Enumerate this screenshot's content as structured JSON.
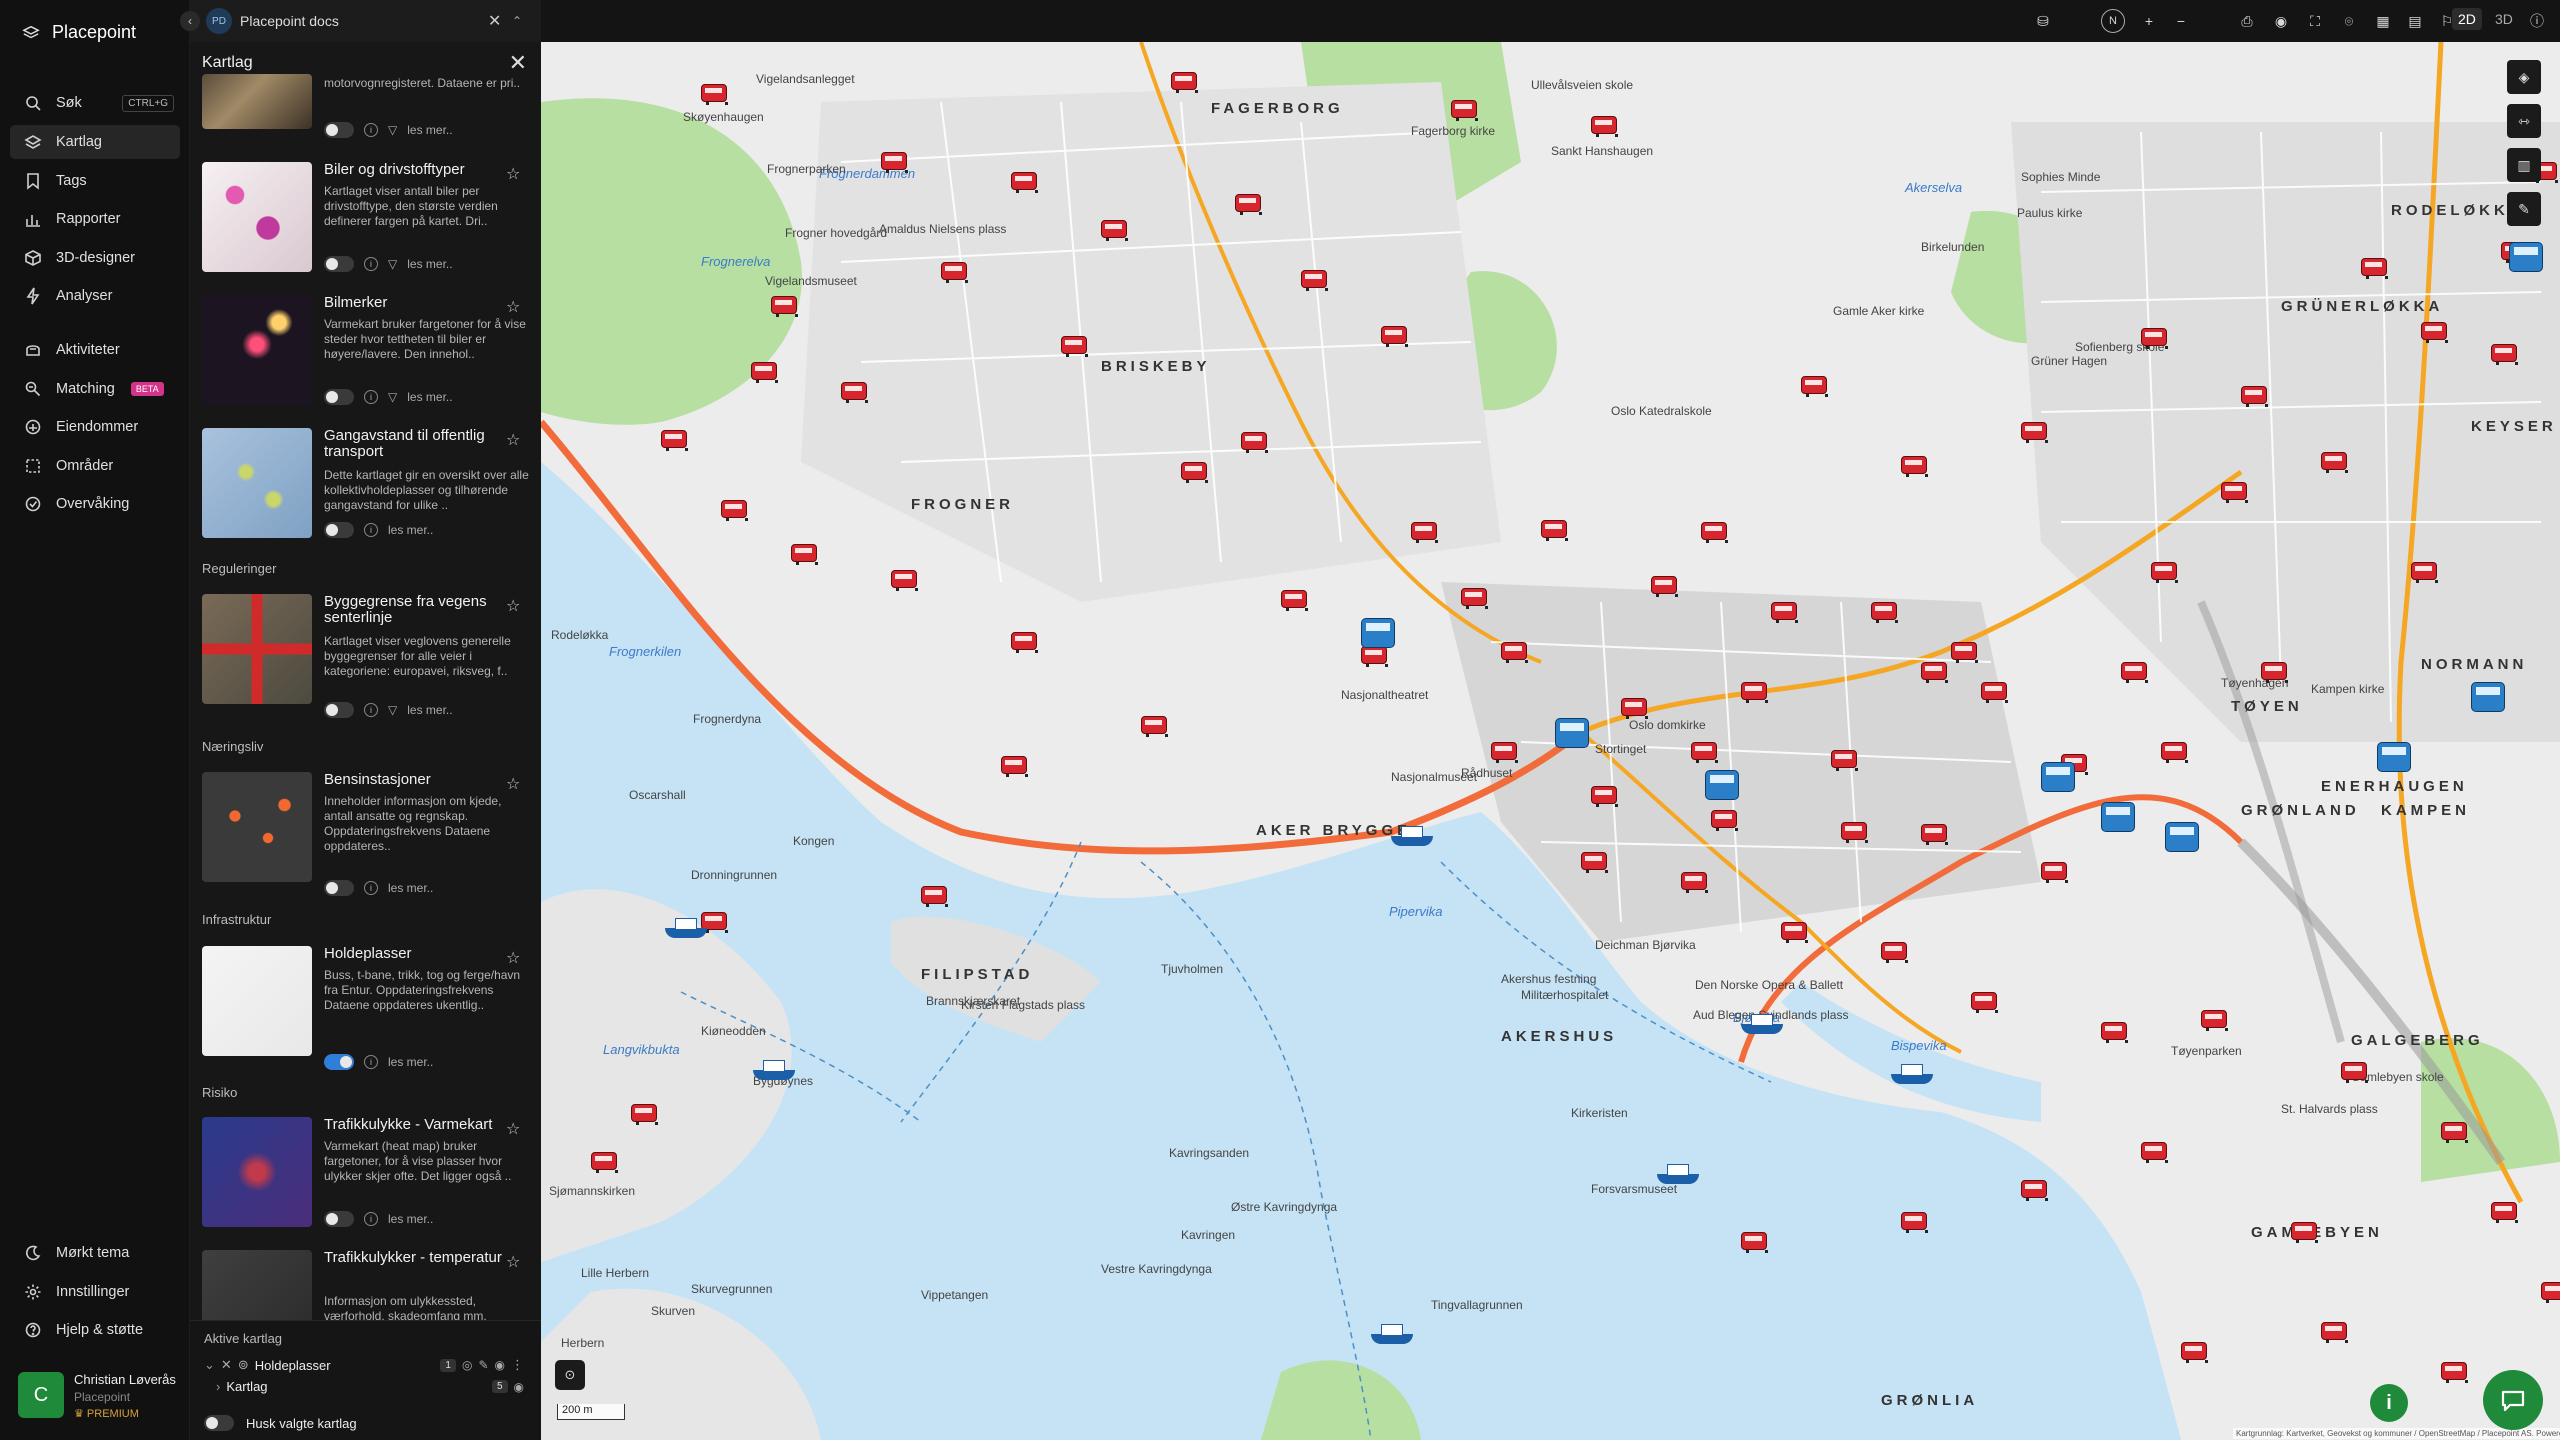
{
  "app": {
    "name": "Placepoint",
    "doc_badge": "PD",
    "doc_title": "Placepoint docs"
  },
  "nav": {
    "items": [
      {
        "label": "Søk",
        "icon": "search-icon",
        "shortcut": "CTRL+G"
      },
      {
        "label": "Kartlag",
        "icon": "layers-icon"
      },
      {
        "label": "Tags",
        "icon": "bookmark-icon"
      },
      {
        "label": "Rapporter",
        "icon": "chart-icon"
      },
      {
        "label": "3D-designer",
        "icon": "cube-icon"
      },
      {
        "label": "Analyser",
        "icon": "bolt-icon"
      },
      {
        "label": "Aktiviteter",
        "icon": "activity-icon"
      },
      {
        "label": "Matching",
        "icon": "matching-icon",
        "badge": "BETA"
      },
      {
        "label": "Eiendommer",
        "icon": "building-icon"
      },
      {
        "label": "Områder",
        "icon": "area-icon"
      },
      {
        "label": "Overvåking",
        "icon": "monitor-icon"
      }
    ],
    "bottom": [
      {
        "label": "Mørkt tema",
        "icon": "moon-icon"
      },
      {
        "label": "Innstillinger",
        "icon": "settings-icon"
      },
      {
        "label": "Hjelp & støtte",
        "icon": "help-icon"
      }
    ],
    "user": {
      "initial": "C",
      "name": "Christian Løverås",
      "org": "Placepoint",
      "tier": "PREMIUM"
    }
  },
  "panel": {
    "title": "Kartlag",
    "top_card": {
      "desc": "motorvognregisteret. Dataene er pri..",
      "more": "les mer.."
    },
    "sections": {
      "regulations": "Reguleringer",
      "business": "Næringsliv",
      "infrastructure": "Infrastruktur",
      "risk": "Risiko"
    },
    "cards": [
      {
        "title": "Biler og drivstofftyper",
        "desc": "Kartlaget viser antall biler per drivstofftype, den største verdien definerer fargen på kartet. Dri..",
        "more": "les mer.."
      },
      {
        "title": "Bilmerker",
        "desc": "Varmekart bruker fargetoner for å vise steder hvor tettheten til biler er høyere/lavere. Den innehol..",
        "more": "les mer.."
      },
      {
        "title": "Gangavstand til offentlig transport",
        "desc": "Dette kartlaget gir en oversikt over alle kollektivholdeplasser og tilhørende gangavstand for ulike ..",
        "more": "les mer.."
      },
      {
        "title": "Byggegrense fra vegens senterlinje",
        "desc": "Kartlaget viser veglovens generelle byggegrenser for alle veier i kategoriene: europavei, riksveg, f..",
        "more": "les mer.."
      },
      {
        "title": "Bensinstasjoner",
        "desc": "Inneholder informasjon om kjede, antall ansatte og regnskap. Oppdateringsfrekvens Dataene oppdateres..",
        "more": "les mer.."
      },
      {
        "title": "Holdeplasser",
        "desc": "Buss, t-bane, trikk, tog og ferge/havn fra Entur. Oppdateringsfrekvens Dataene oppdateres ukentlig..",
        "more": "les mer.."
      },
      {
        "title": "Trafikkulykke - Varmekart",
        "desc": "Varmekart (heat map) bruker fargetoner, for å vise plasser hvor ulykker skjer ofte. Det ligger også ..",
        "more": "les mer.."
      },
      {
        "title": "Trafikkulykker - temperatur",
        "desc": "Informasjon om ulykkessted, værforhold, skadeomfang mm.",
        "more": ""
      }
    ],
    "active": {
      "header": "Aktive kartlag",
      "layer1": "Holdeplasser",
      "layer1_count": "1",
      "layer2": "Kartlag",
      "layer2_count": "5",
      "remember": "Husk valgte kartlag"
    }
  },
  "topbar": {
    "mode_2d": "2D",
    "mode_3d": "3D",
    "north": "N"
  },
  "map": {
    "scale": "200 m",
    "attribution": "Kartgrunnlag: Kartverket, Geovekst og kommuner / OpenStreetMap / Placepoint AS. Powered by Esri",
    "districts": [
      "FAGERBORG",
      "RODELØKKA",
      "GRÜNERLØKKA",
      "BRISKEBY",
      "FROGNER",
      "KEYSER",
      "AKER BRYGGE",
      "FILIPSTAD",
      "AKERSHUS",
      "GRØNLAND",
      "ENERHAUGEN",
      "TØYEN",
      "NORMANN",
      "KAMPEN",
      "GALGEBERG",
      "GAMLEBYEN",
      "GRØNLIA"
    ],
    "water": [
      "Frognerelva",
      "Frognerdammen",
      "Akerselva",
      "Frognerkilen",
      "Pipervika",
      "Bjørvika",
      "Bispevika",
      "Langvikbukta"
    ],
    "places": [
      "Vigelandsanlegget",
      "Skøyenhaugen",
      "Frognerparken",
      "Frogner hovedgård",
      "Vigelandsmuseet",
      "Amaldus Nielsens plass",
      "Fagerborg kirke",
      "Ullevålsveien skole",
      "Sankt Hanshaugen",
      "Gamle Aker kirke",
      "Sophies Minde",
      "Paulus kirke",
      "Birkelunden",
      "Grüner Hagen",
      "Frognerdyna",
      "Oscarshall",
      "Kongen",
      "Dronningrunnen",
      "Rodeløkka",
      "Brannskjærskaret",
      "Tjuvholmen",
      "Kiøneodden",
      "Bygdøynes",
      "Sjømannskirken",
      "Kavringsanden",
      "Kavringen",
      "Østre Kavringdynga",
      "Vestre Kavringdynga",
      "Lille Herbern",
      "Skurvegrunnen",
      "Skurven",
      "Herbern",
      "Tingvallagrunnen",
      "Akershus festning",
      "Militærhospitalet",
      "Den Norske Opera & Ballett",
      "Aud Blegen Svindlands plass",
      "Deichman Bjørvika",
      "Nasjonalmuseet",
      "Rådhuset",
      "Oslo domkirke",
      "Stortinget",
      "Nasjonaltheatret",
      "Oslo Katedralskole",
      "Sofienberg skole",
      "Kampen kirke",
      "Tøyenhagen",
      "Tøyenparken",
      "Gamlebyen skole",
      "St. Halvards plass",
      "Kirkeristen",
      "Forsvarsmuseet",
      "Vippetangen",
      "Kirsten Flagstads plass",
      "Filipstad"
    ]
  }
}
